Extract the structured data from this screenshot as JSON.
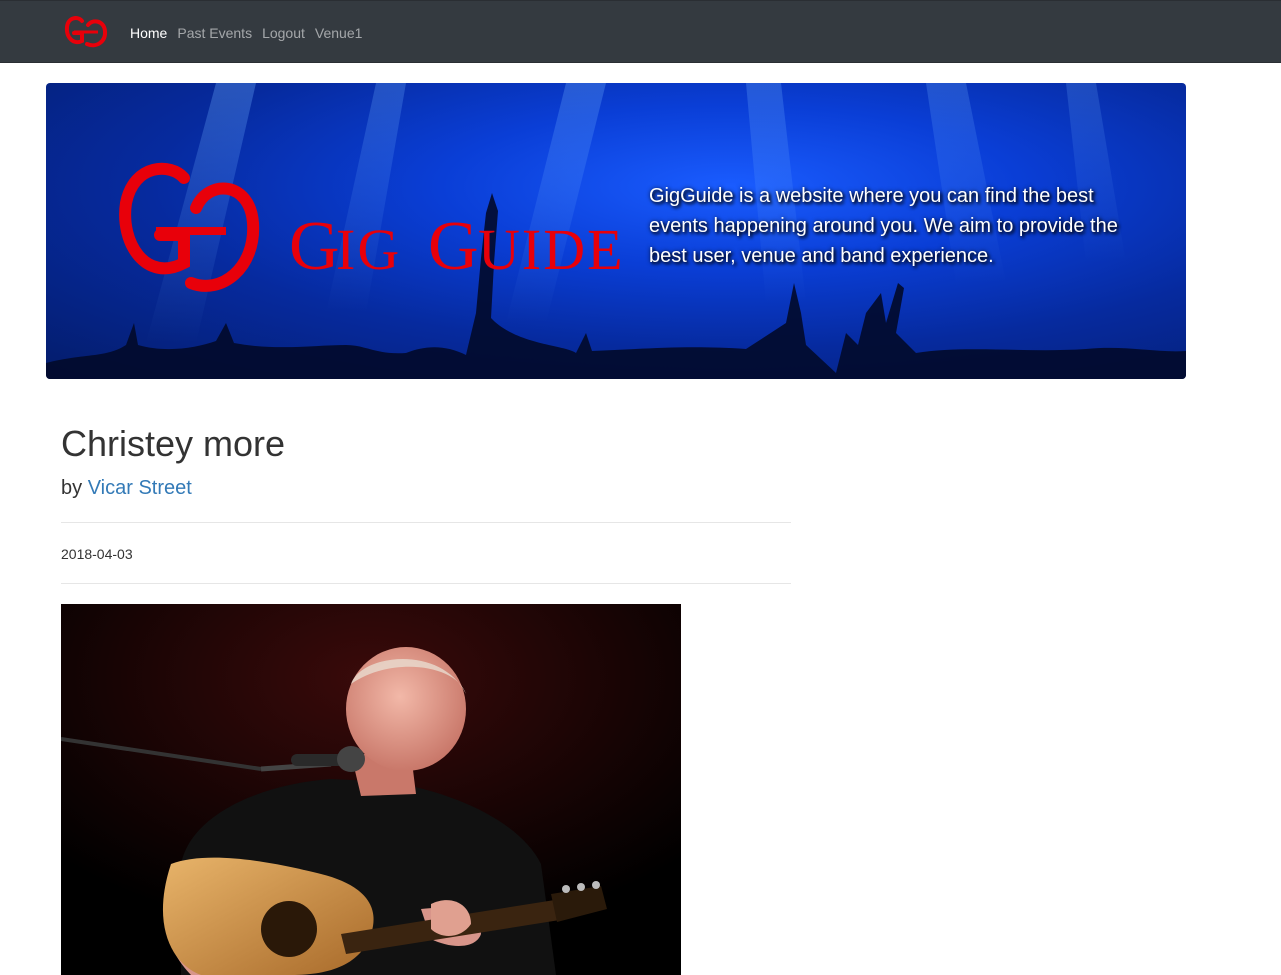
{
  "navbar": {
    "links": [
      {
        "label": "Home",
        "active": true
      },
      {
        "label": "Past Events",
        "active": false
      },
      {
        "label": "Logout",
        "active": false
      },
      {
        "label": "Venue1",
        "active": false
      }
    ],
    "logo_icon": "gigguide-logo-icon"
  },
  "hero": {
    "logo_wordmark": "GigGuide",
    "description": "GigGuide is a website where you can find the best events happening around you. We aim to provide the best user, venue and band experience."
  },
  "event": {
    "title": "Christey more",
    "by_prefix": "by",
    "venue": "Vicar Street",
    "date": "2018-04-03"
  },
  "colors": {
    "navbar_bg": "#343a40",
    "logo_red": "#e8000a",
    "link_blue": "#337ab7",
    "hero_blue": "#0a3ed6"
  }
}
